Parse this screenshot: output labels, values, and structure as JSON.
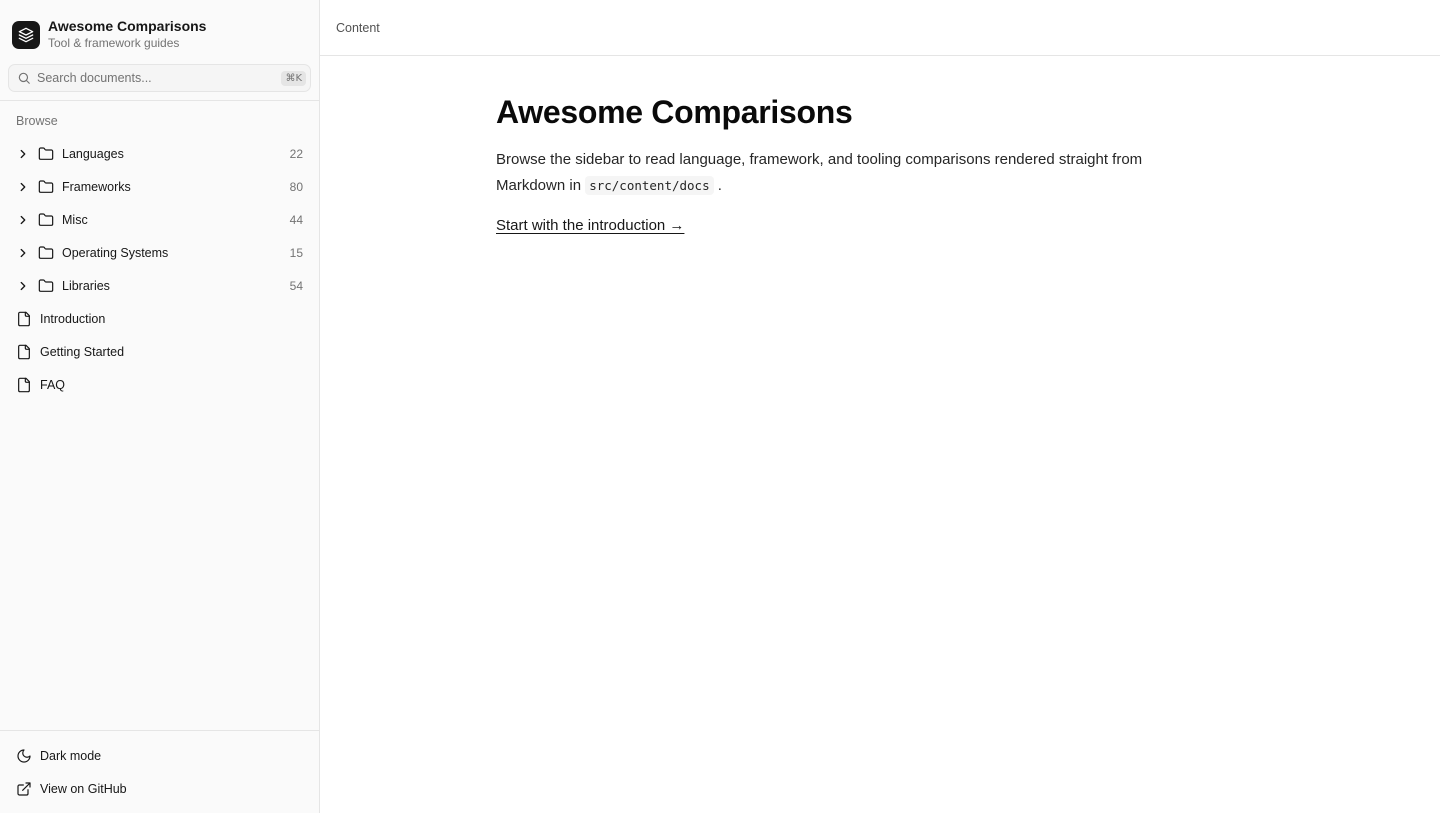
{
  "brand": {
    "title": "Awesome Comparisons",
    "subtitle": "Tool & framework guides",
    "logo_icon": "layers-icon"
  },
  "search": {
    "placeholder": "Search documents...",
    "shortcut": "⌘K"
  },
  "nav": {
    "section_label": "Browse",
    "folders": [
      {
        "label": "Languages",
        "count": "22"
      },
      {
        "label": "Frameworks",
        "count": "80"
      },
      {
        "label": "Misc",
        "count": "44"
      },
      {
        "label": "Operating Systems",
        "count": "15"
      },
      {
        "label": "Libraries",
        "count": "54"
      }
    ],
    "pages": [
      {
        "label": "Introduction"
      },
      {
        "label": "Getting Started"
      },
      {
        "label": "FAQ"
      }
    ]
  },
  "footer": {
    "dark_mode_label": "Dark mode",
    "github_label": "View on GitHub"
  },
  "topbar": {
    "breadcrumb": "Content"
  },
  "main": {
    "title": "Awesome Comparisons",
    "intro_before": "Browse the sidebar to read language, framework, and tooling comparisons rendered straight from Markdown in ",
    "intro_code": "src/content/docs",
    "intro_after": ".",
    "cta": "Start with the introduction →"
  },
  "colors": {
    "accent": "#171717",
    "muted": "#737373",
    "border": "#e5e5e5",
    "sidebar_bg": "#fafafa"
  }
}
